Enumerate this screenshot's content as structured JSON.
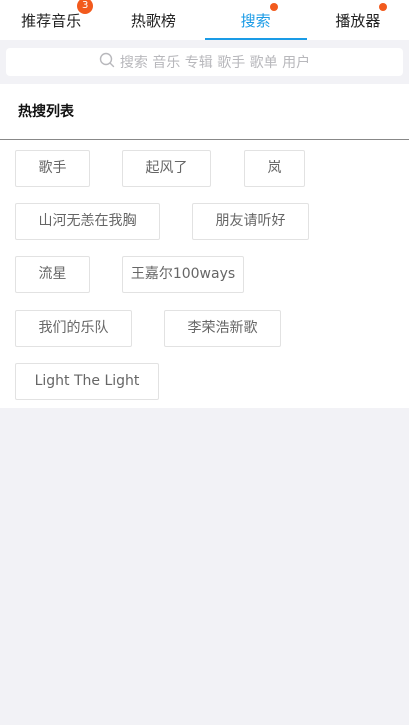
{
  "tabs": [
    {
      "label": "推荐音乐",
      "badge": "3"
    },
    {
      "label": "热歌榜"
    },
    {
      "label": "搜索",
      "active": true,
      "dot": true
    },
    {
      "label": "播放器",
      "dot": true
    }
  ],
  "search": {
    "placeholder": "搜索 音乐 专辑 歌手 歌单 用户"
  },
  "hot": {
    "title": "热搜列表",
    "tags": [
      "歌手",
      "起风了",
      "岚",
      "山河无恙在我胸",
      "朋友请听好",
      "流星",
      "王嘉尔100ways",
      "我们的乐队",
      "李荣浩新歌",
      "Light The Light"
    ]
  },
  "colors": {
    "accent": "#1a9be6",
    "badge": "#f25a1d",
    "background": "#f2f2f6"
  }
}
